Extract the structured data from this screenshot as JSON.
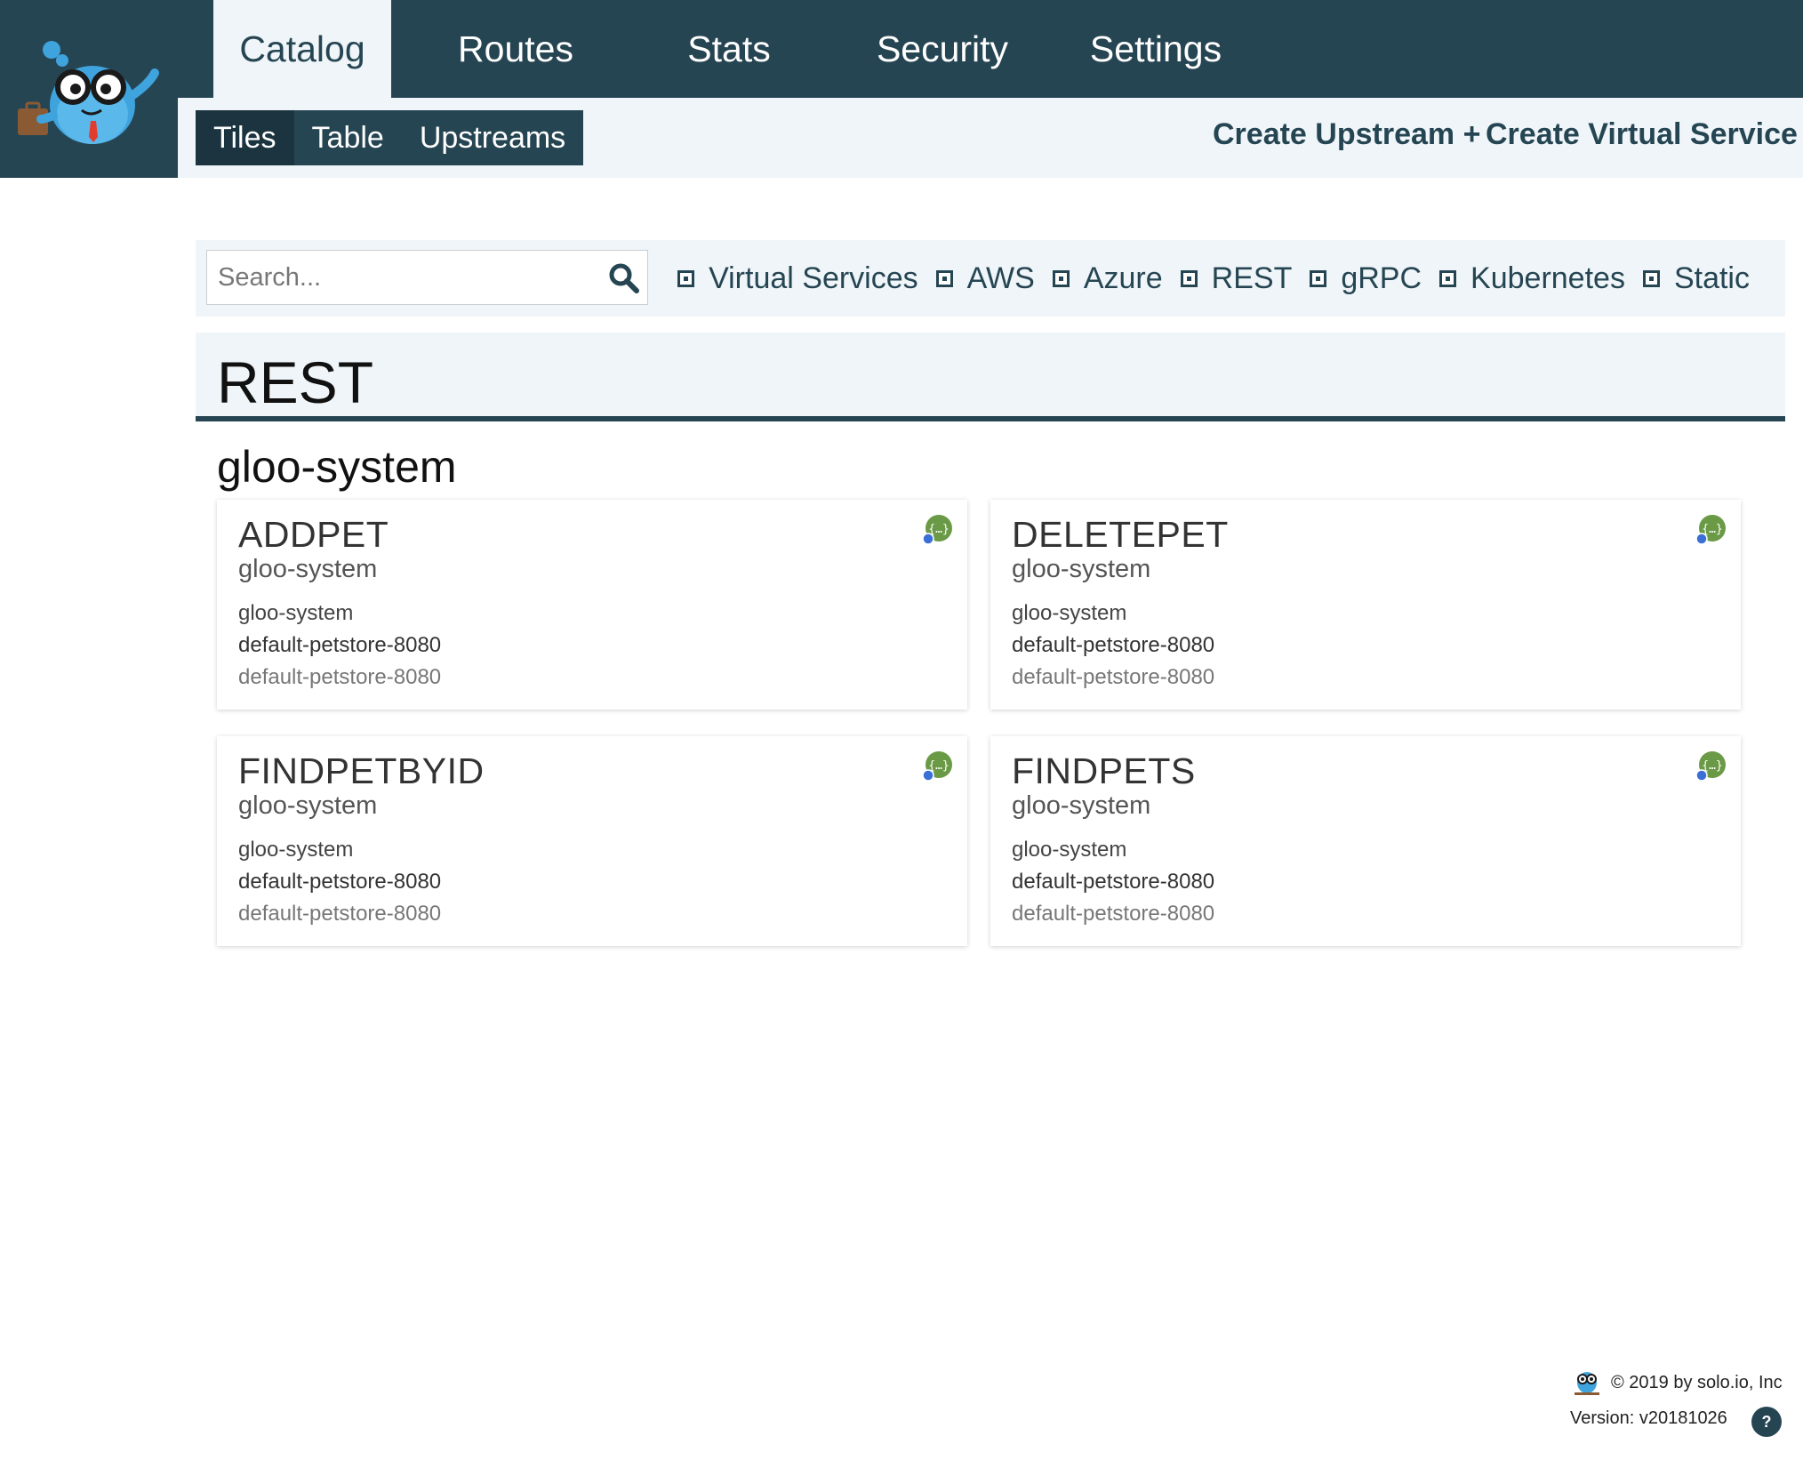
{
  "nav": {
    "tabs": [
      {
        "label": "Catalog",
        "active": true
      },
      {
        "label": "Routes",
        "active": false
      },
      {
        "label": "Stats",
        "active": false
      },
      {
        "label": "Security",
        "active": false
      },
      {
        "label": "Settings",
        "active": false
      }
    ]
  },
  "subnav": {
    "tabs": [
      {
        "label": "Tiles",
        "active": true
      },
      {
        "label": "Table",
        "active": false
      },
      {
        "label": "Upstreams",
        "active": false
      }
    ],
    "create_upstream": "Create Upstream +",
    "create_virtual_service": "Create Virtual Service +"
  },
  "search": {
    "placeholder": "Search...",
    "value": ""
  },
  "filters": [
    "Virtual Services",
    "AWS",
    "Azure",
    "REST",
    "gRPC",
    "Kubernetes",
    "Static"
  ],
  "section": {
    "title": "REST",
    "group": "gloo-system"
  },
  "cards": [
    {
      "title": "ADDPET",
      "subtitle": "gloo-system",
      "line1": "gloo-system",
      "line2": "default-petstore-8080",
      "line3": "default-petstore-8080",
      "icon": "rest-function-icon"
    },
    {
      "title": "DELETEPET",
      "subtitle": "gloo-system",
      "line1": "gloo-system",
      "line2": "default-petstore-8080",
      "line3": "default-petstore-8080",
      "icon": "rest-function-icon"
    },
    {
      "title": "FINDPETBYID",
      "subtitle": "gloo-system",
      "line1": "gloo-system",
      "line2": "default-petstore-8080",
      "line3": "default-petstore-8080",
      "icon": "rest-function-icon"
    },
    {
      "title": "FINDPETS",
      "subtitle": "gloo-system",
      "line1": "gloo-system",
      "line2": "default-petstore-8080",
      "line3": "default-petstore-8080",
      "icon": "rest-function-icon"
    }
  ],
  "footer": {
    "copyright": "© 2019 by solo.io, Inc",
    "version": "Version: v20181026",
    "help": "?"
  },
  "colors": {
    "primary": "#264553",
    "light_bg": "#eff5f8",
    "icon_green": "#6a9a45",
    "icon_blue": "#3a6fd8"
  }
}
